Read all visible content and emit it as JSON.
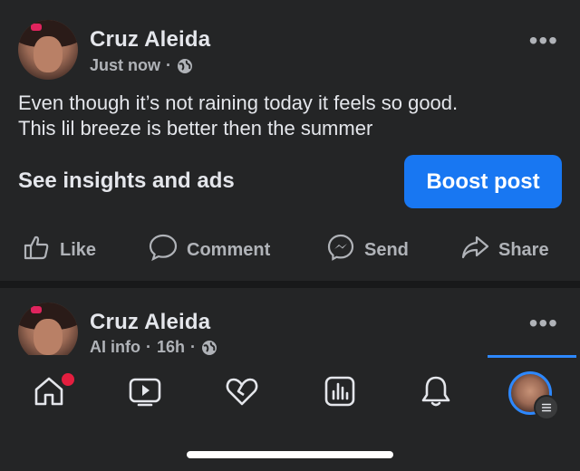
{
  "posts": [
    {
      "author": "Cruz Aleida",
      "meta_time": "Just now",
      "meta_sep": "·",
      "privacy_icon": "globe-icon",
      "text_line1": "Even though it’s not raining today it feels so good.",
      "text_line2": "This lil breeze is better then the summer",
      "insights_label": "See insights and ads",
      "boost_label": "Boost post",
      "more_label": "•••"
    },
    {
      "author": "Cruz Aleida",
      "meta_info": "AI info",
      "meta_sep": "·",
      "meta_time": "16h",
      "meta_sep2": "·",
      "privacy_icon": "globe-icon",
      "more_label": "•••"
    }
  ],
  "actions": {
    "like": "Like",
    "comment": "Comment",
    "send": "Send",
    "share": "Share"
  },
  "tabbar": {
    "items": [
      "home-icon",
      "video-icon",
      "heart-icon",
      "dashboard-icon",
      "bell-icon",
      "profile-avatar"
    ],
    "active": "profile-avatar",
    "home_has_notification": true
  },
  "colors": {
    "background": "#242526",
    "divider": "#18191a",
    "accent": "#1877f2",
    "text": "#e4e6eb",
    "secondary_text": "#b0b3b8",
    "notification": "#e41e3f"
  }
}
